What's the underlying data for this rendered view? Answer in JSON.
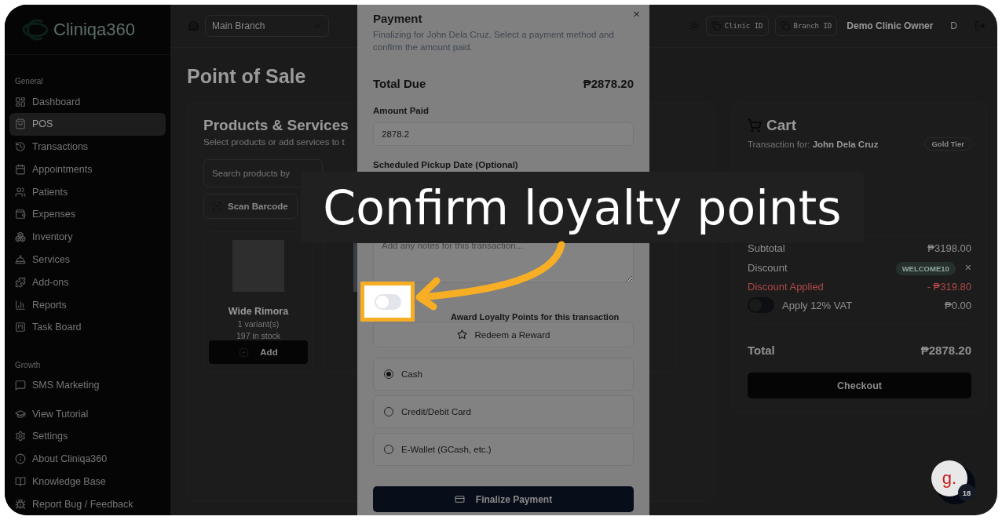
{
  "sidebar": {
    "logo": "Cliniqa360",
    "sections": [
      {
        "title": "General",
        "items": [
          {
            "label": "Dashboard",
            "selected": false
          },
          {
            "label": "POS",
            "selected": true
          },
          {
            "label": "Transactions",
            "selected": false
          },
          {
            "label": "Appointments",
            "selected": false
          },
          {
            "label": "Patients",
            "selected": false
          },
          {
            "label": "Expenses",
            "selected": false
          },
          {
            "label": "Inventory",
            "selected": false
          },
          {
            "label": "Services",
            "selected": false
          },
          {
            "label": "Add-ons",
            "selected": false
          },
          {
            "label": "Reports",
            "selected": false
          },
          {
            "label": "Task Board",
            "selected": false
          }
        ]
      },
      {
        "title": "Growth",
        "items": [
          {
            "label": "SMS Marketing",
            "selected": false
          }
        ]
      }
    ],
    "footer_items": [
      "View Tutorial",
      "Settings",
      "About Cliniqa360",
      "Knowledge Base",
      "Report Bug / Feedback"
    ]
  },
  "header": {
    "branch": "Main Branch",
    "clinic_id": "Clinic ID",
    "branch_id": "Branch ID",
    "user": "Demo Clinic Owner",
    "avatar": "D"
  },
  "page_title": "Point of Sale",
  "products": {
    "title": "Products & Services",
    "subtitle": "Select products or add services to t",
    "search": {
      "placeholder": "Search products by"
    },
    "scan_button": "Scan Barcode",
    "items": [
      {
        "name": "Wide Rimora",
        "variants": "1 variant(s)",
        "stock": "197 in stock",
        "add": "Add"
      }
    ]
  },
  "cart": {
    "title": "Cart",
    "customer": "Transaction for: **John Dela Cruz**",
    "tier": "Gold Tier",
    "subtotal": {
      "label": "Subtotal",
      "value": "₱3198.00"
    },
    "discount": {
      "label": "Discount",
      "code": "WELCOME10",
      "remove": "×"
    },
    "discount_applied": {
      "label": "Discount Applied",
      "value": "- ₱319.80"
    },
    "vat": {
      "label": "Apply 12% VAT",
      "on": false,
      "value": "₱0.00"
    },
    "total": {
      "label": "Total",
      "value": "₱2878.20"
    },
    "checkout": "Checkout"
  },
  "payment_dialog": {
    "title": "Payment",
    "close": "×",
    "description": "Finalizing for John Dela Cruz. Select a payment method and confirm the amount paid.",
    "total_due": {
      "label": "Total Due",
      "value": "₱2878.20"
    },
    "amount_paid": {
      "label": "Amount Paid",
      "value": "2878.2"
    },
    "pickup_date": {
      "label": "Scheduled Pickup Date (Optional)"
    },
    "remarks": {
      "placeholder": "Add any notes for this transaction..."
    },
    "award": {
      "label": "Award Loyalty Points for this transaction",
      "on": false
    },
    "redeem": "Redeem a Reward",
    "methods": [
      {
        "label": "Cash",
        "selected": true
      },
      {
        "label": "Credit/Debit Card",
        "selected": false
      },
      {
        "label": "E-Wallet (GCash, etc.)",
        "selected": false
      }
    ],
    "finalize": "Finalize Payment"
  },
  "tutorial": {
    "caption": "Confirm loyalty points"
  },
  "chat_widget": {
    "logo": "g.",
    "badge": "18"
  }
}
